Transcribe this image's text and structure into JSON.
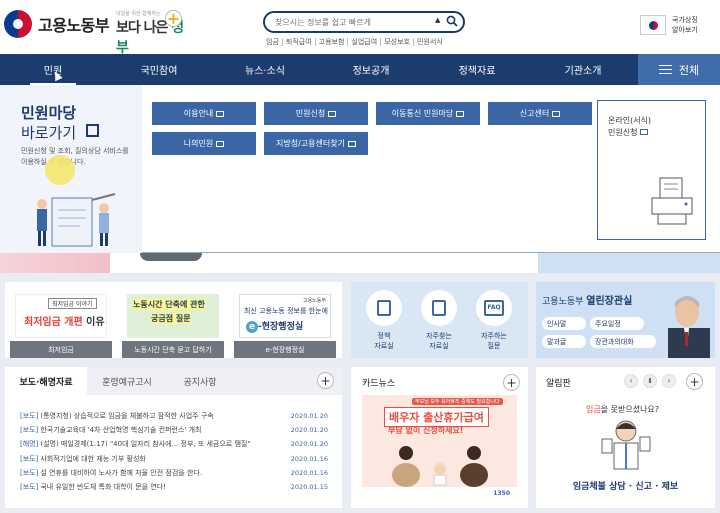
{
  "header": {
    "logo_text": "고용노동부",
    "slogan_small": "내일을 위한 함께하는",
    "slogan_big_1": "보다 나은 ",
    "slogan_big_2": "정부",
    "search_placeholder": "찾으시는 정보를 쉽고 빠르게",
    "quick_links": [
      "임금",
      "퇴직급여",
      "고용보험",
      "실업급여",
      "모성보호",
      "민원서식"
    ],
    "nation_line1": "국가상징",
    "nation_line2": "알아보기"
  },
  "nav": {
    "items": [
      "민원",
      "국민참여",
      "뉴스·소식",
      "정보공개",
      "정책자료",
      "기관소개"
    ],
    "all_label": "전체"
  },
  "mega": {
    "title1": "민원마당",
    "title2": "바로가기",
    "desc": "민원신청 및 조회, 질의상담 서비스를 이용하실 수 있습니다.",
    "buttons": [
      "이용안내",
      "민원신청",
      "이동통신 민원마당",
      "신고센터",
      "나의민원",
      "지방청/고용센터찾기"
    ],
    "box_line1": "온라인(서식)",
    "box_line2": "민원신청"
  },
  "banners": [
    {
      "tag": "최저임금 이야기",
      "head_red": "최저임금 개편",
      "head_dark": " 이유",
      "caption": "최저임금"
    },
    {
      "line1": "노동시간 단축에 관한",
      "line2": "궁금점 질문",
      "caption": "노동시간 단축 묻고 답하기"
    },
    {
      "small": "고용노동부",
      "line1": "최신 고용노동 정보를 한눈에",
      "line2_e": "e",
      "line2": "-현장행정실",
      "caption": "e-현장행정실"
    }
  ],
  "icons": [
    {
      "l1": "정책",
      "l2": "자료실"
    },
    {
      "l1": "자주찾는",
      "l2": "자료실"
    },
    {
      "l1": "자주하는",
      "l2": "질문",
      "glyph": "FAQ"
    }
  ],
  "minister": {
    "title_a": "고용노동부 ",
    "title_b": "열린장관실",
    "pills": [
      "인사말",
      "주요일정",
      "말과글",
      "장관과의대화"
    ]
  },
  "press": {
    "tabs": [
      "보도·해명자료",
      "훈령예규고시",
      "공지사항"
    ],
    "rows": [
      {
        "cat": "[보도]",
        "title": "(통영지청) 상습적으로 임금을 체불하고 잠적한 사업주 구속",
        "date": "2020.01.20"
      },
      {
        "cat": "[보도]",
        "title": "한국기술교육대 '4차 산업혁명 핵심기술 컨퍼런스' 개최",
        "date": "2020.01.20"
      },
      {
        "cat": "[해명]",
        "title": "(설명) 매일경제(1.17) \"40대 일자리 참사에... 정부, 또 세금으로 땜질\"",
        "date": "2020.01.20"
      },
      {
        "cat": "[보도]",
        "title": "사회적기업에 대한 재능 기부 활성화",
        "date": "2020.01.16"
      },
      {
        "cat": "[보도]",
        "title": "설 연휴를 대비하여 노사가 함께 자율 안전 점검을 한다.",
        "date": "2020.01.16"
      },
      {
        "cat": "[보도]",
        "title": "국내 유일한 반도체 특화 대학이 문을 연다!",
        "date": "2020.01.15"
      }
    ]
  },
  "cardnews": {
    "title": "카드뉴스",
    "poster_small": "부모님 모두 육아휴직 중에도 필요합니다",
    "poster_h1": "배우자 출산휴가급여",
    "poster_h2": "부담 없이 신청하세요!",
    "poster_num": "1350"
  },
  "notice": {
    "title": "알림판",
    "q_red": "임금",
    "q_rest": "을 못받으셨나요?",
    "bottom": "임금체불 상담 · 신고 · 제보"
  },
  "colors": {
    "navy": "#1d3c6e",
    "button_blue": "#3b66a6",
    "accent_red": "#e4403c"
  }
}
